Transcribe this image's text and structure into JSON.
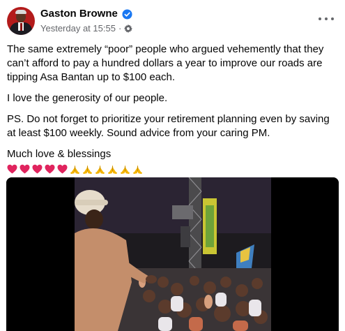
{
  "post": {
    "author": "Gaston Browne",
    "verified": true,
    "timestamp": "Yesterday at 15:55",
    "separator": "·",
    "audience_icon": "settings-gear-icon",
    "more_options_icon": "more-horizontal-icon",
    "paragraphs": [
      "The same extremely “poor” people who argued vehemently that they can’t afford to pay a hundred dollars a year to improve our roads are tipping Asa Bantan up to $100 each.",
      "I love the generosity of our people.",
      "PS. Do not forget to prioritize your retirement planning even by saving at least $100 weekly.  Sound advice from your caring PM.",
      "Much love & blessings"
    ],
    "emoji_line": {
      "hearts": 5,
      "praying_hands": 6,
      "heart_color": "#e0245e",
      "pray_color": "#f4b400"
    },
    "media": {
      "type": "video",
      "description_icon": "video-thumbnail"
    }
  },
  "colors": {
    "text": "#050505",
    "secondary": "#65676b",
    "verified": "#1877f2",
    "avatar_bg": "#b31b1b"
  }
}
